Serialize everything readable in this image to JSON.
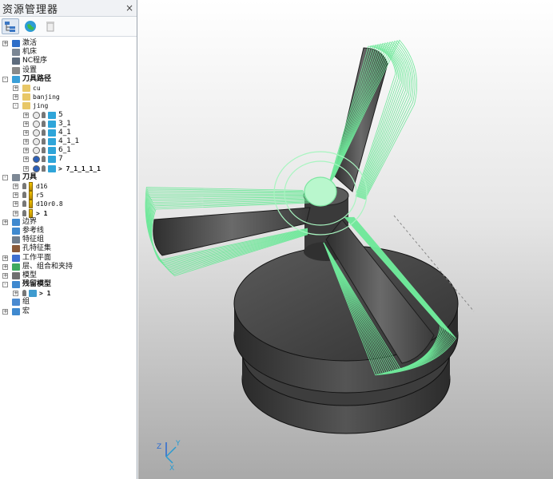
{
  "explorer": {
    "title": "资源管理器",
    "close_glyph": "×",
    "toolbar": [
      "tree-view-icon",
      "globe-icon",
      "trash-icon"
    ],
    "tree": [
      {
        "text": "激活",
        "indent": 0,
        "icon": "activate-icon",
        "expander": "+",
        "bold": false,
        "mono": false
      },
      {
        "text": "机床",
        "indent": 0,
        "icon": "machine-icon",
        "expander": "",
        "bold": false,
        "mono": false
      },
      {
        "text": "NC程序",
        "indent": 0,
        "icon": "nc-program-icon",
        "expander": "",
        "bold": false,
        "mono": false
      },
      {
        "text": "设置",
        "indent": 0,
        "icon": "setup-icon",
        "expander": "",
        "bold": false,
        "mono": false
      },
      {
        "text": "刀具路径",
        "indent": 0,
        "icon": "toolpath-icon",
        "expander": "-",
        "bold": true,
        "mono": false
      },
      {
        "text": "cu",
        "indent": 1,
        "icon": "folder-icon",
        "expander": "+",
        "bold": false,
        "mono": true
      },
      {
        "text": "banjing",
        "indent": 1,
        "icon": "folder-icon",
        "expander": "+",
        "bold": false,
        "mono": true
      },
      {
        "text": "jing",
        "indent": 1,
        "icon": "folder-icon",
        "expander": "-",
        "bold": false,
        "mono": true
      },
      {
        "text": "5",
        "indent": 2,
        "icon": "toolpath-item-icon",
        "expander": "+",
        "bold": false,
        "mono": false,
        "status": "done"
      },
      {
        "text": "3_1",
        "indent": 2,
        "icon": "toolpath-item-icon",
        "expander": "+",
        "bold": false,
        "mono": false,
        "status": "done"
      },
      {
        "text": "4_1",
        "indent": 2,
        "icon": "toolpath-item-icon",
        "expander": "+",
        "bold": false,
        "mono": false,
        "status": "done"
      },
      {
        "text": "4_1_1",
        "indent": 2,
        "icon": "toolpath-item-icon",
        "expander": "+",
        "bold": false,
        "mono": false,
        "status": "done"
      },
      {
        "text": "6_1",
        "indent": 2,
        "icon": "toolpath-item-icon",
        "expander": "+",
        "bold": false,
        "mono": false,
        "status": "done"
      },
      {
        "text": "7",
        "indent": 2,
        "icon": "toolpath-item-icon",
        "expander": "+",
        "bold": false,
        "mono": false,
        "status": "active"
      },
      {
        "text": "> 7_1_1_1_1",
        "indent": 2,
        "icon": "toolpath-item-icon",
        "expander": "+",
        "bold": true,
        "mono": true,
        "status": "active"
      },
      {
        "text": "刀具",
        "indent": 0,
        "icon": "tool-group-icon",
        "expander": "-",
        "bold": true,
        "mono": false
      },
      {
        "text": "d16",
        "indent": 1,
        "icon": "tool-icon",
        "expander": "+",
        "bold": false,
        "mono": true
      },
      {
        "text": "r5",
        "indent": 1,
        "icon": "tool-icon",
        "expander": "+",
        "bold": false,
        "mono": true
      },
      {
        "text": "d10r0.8",
        "indent": 1,
        "icon": "tool-icon",
        "expander": "+",
        "bold": false,
        "mono": true
      },
      {
        "text": "> 1",
        "indent": 1,
        "icon": "tool-icon",
        "expander": "+",
        "bold": true,
        "mono": true
      },
      {
        "text": "边界",
        "indent": 0,
        "icon": "boundary-icon",
        "expander": "+",
        "bold": false,
        "mono": false
      },
      {
        "text": "参考线",
        "indent": 0,
        "icon": "pattern-icon",
        "expander": "",
        "bold": false,
        "mono": false
      },
      {
        "text": "特征组",
        "indent": 0,
        "icon": "feature-group-icon",
        "expander": "",
        "bold": false,
        "mono": false
      },
      {
        "text": "孔特征集",
        "indent": 0,
        "icon": "hole-feature-icon",
        "expander": "",
        "bold": false,
        "mono": false
      },
      {
        "text": "工作平面",
        "indent": 0,
        "icon": "workplane-icon",
        "expander": "+",
        "bold": false,
        "mono": false
      },
      {
        "text": "层、组合和夹持",
        "indent": 0,
        "icon": "layer-icon",
        "expander": "+",
        "bold": false,
        "mono": false
      },
      {
        "text": "模型",
        "indent": 0,
        "icon": "model-icon",
        "expander": "+",
        "bold": false,
        "mono": false
      },
      {
        "text": "残留模型",
        "indent": 0,
        "icon": "stock-model-icon",
        "expander": "-",
        "bold": true,
        "mono": false
      },
      {
        "text": "> 1",
        "indent": 1,
        "icon": "stock-item-icon",
        "expander": "+",
        "bold": true,
        "mono": true
      },
      {
        "text": "组",
        "indent": 0,
        "icon": "group-icon",
        "expander": "",
        "bold": false,
        "mono": false
      },
      {
        "text": "宏",
        "indent": 0,
        "icon": "macro-icon",
        "expander": "+",
        "bold": false,
        "mono": false
      }
    ]
  },
  "viewport": {
    "axis_labels": {
      "x": "X",
      "y": "Y",
      "z": "Z"
    },
    "colors": {
      "toolpath": "#6fe89a",
      "model": "#4a4a4a",
      "highlight": "#a8f5c0"
    }
  }
}
